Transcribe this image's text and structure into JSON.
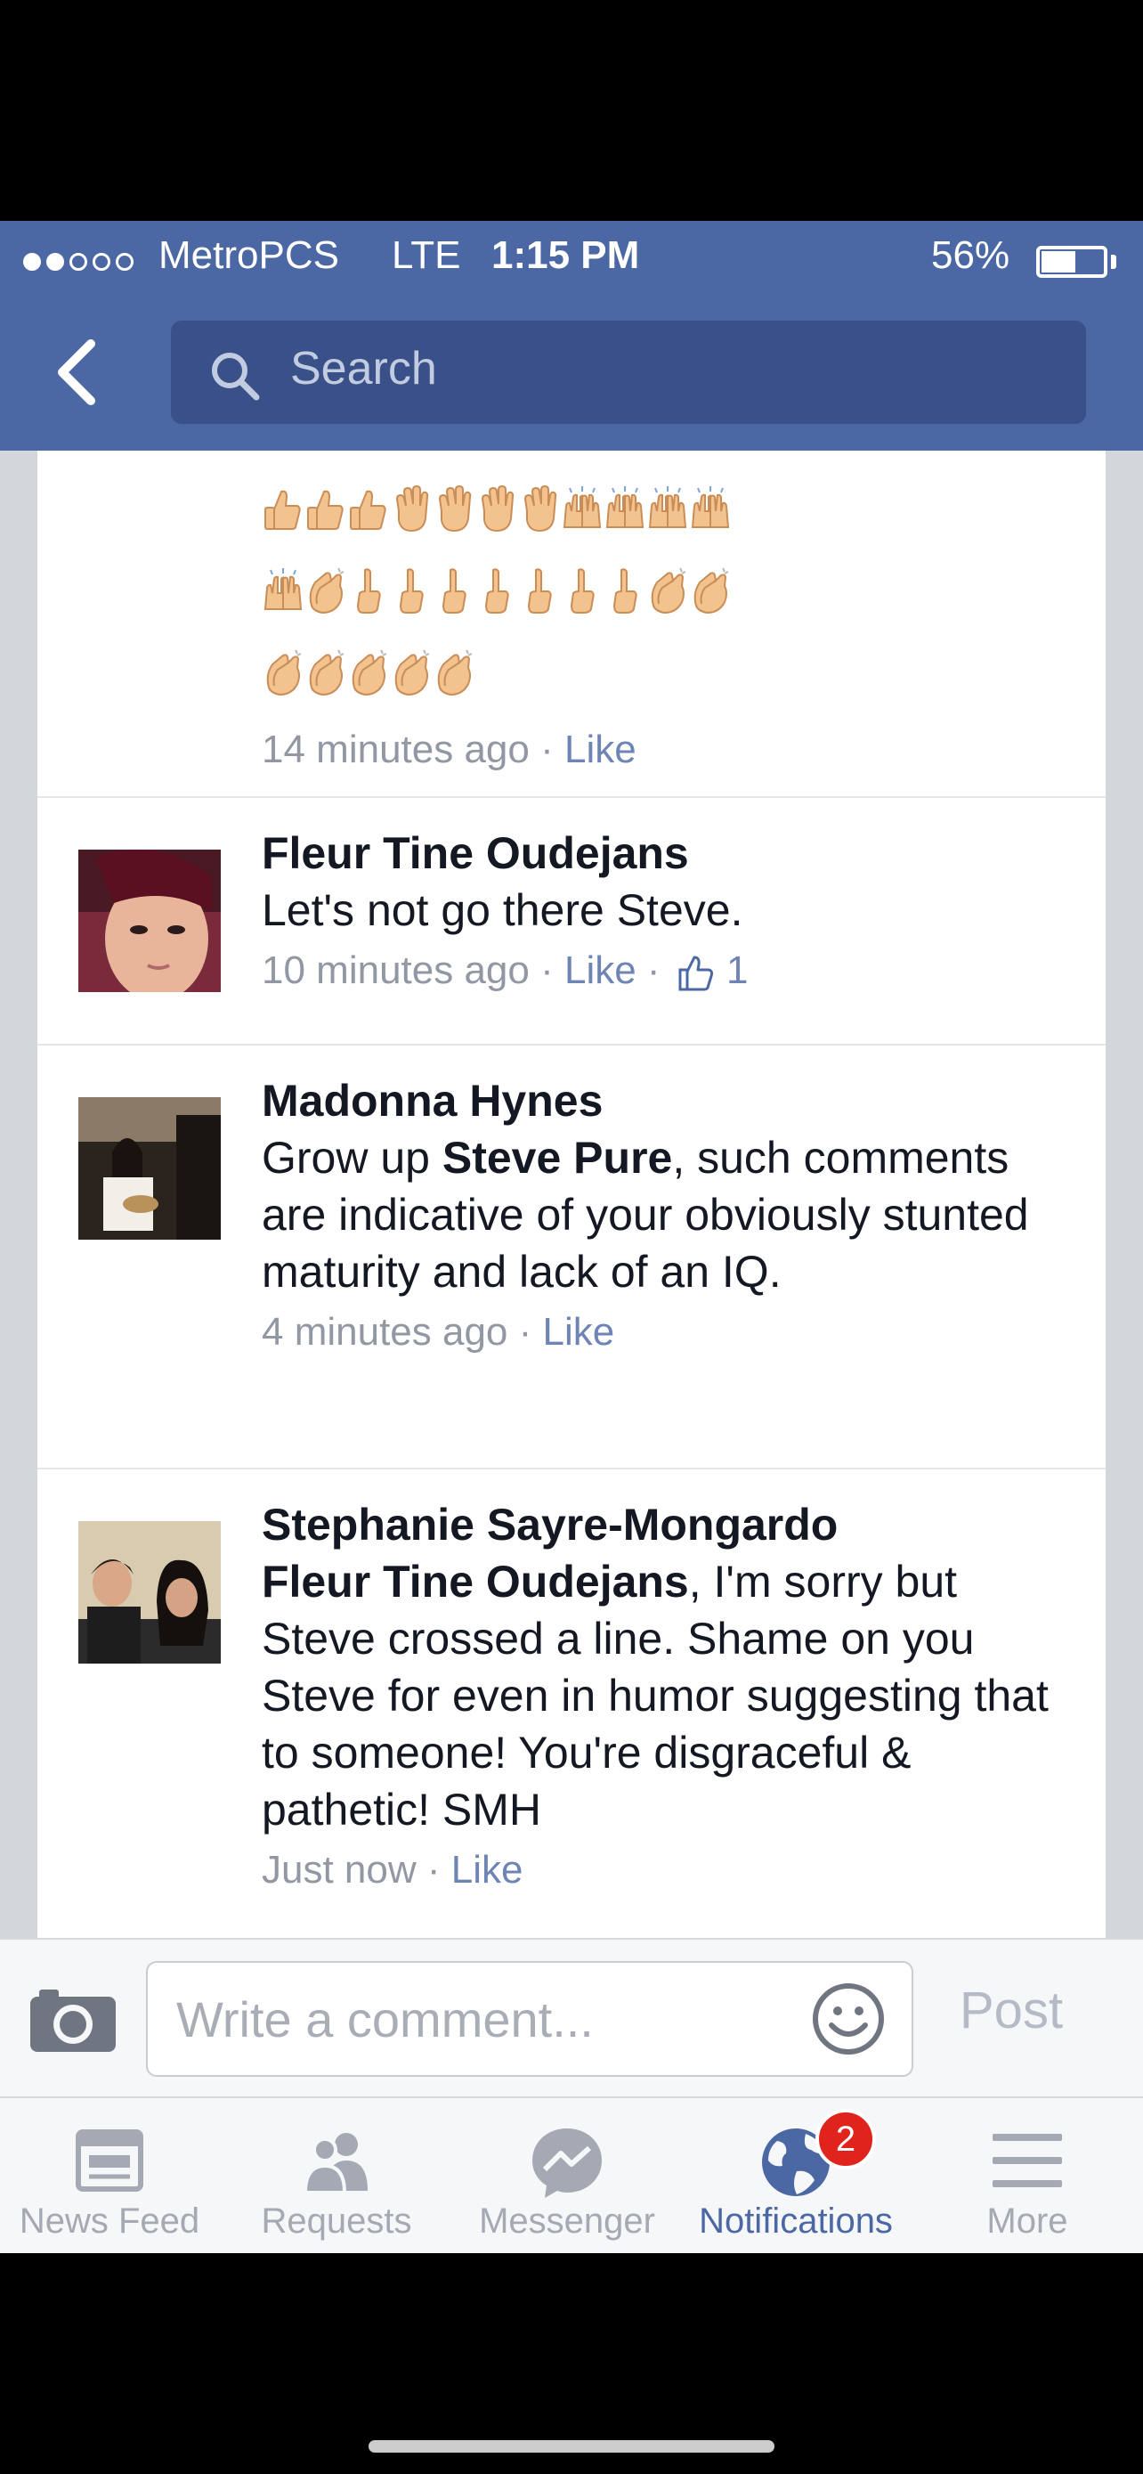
{
  "status_bar": {
    "carrier": "MetroPCS",
    "network": "LTE",
    "time": "1:15 PM",
    "battery_percent": "56%",
    "signal_bars_filled": 2,
    "signal_bars_total": 5,
    "battery_level": 0.56
  },
  "nav": {
    "back_icon": "chevron-left-icon",
    "search_placeholder": "Search",
    "search_icon": "search-icon"
  },
  "comments": [
    {
      "emoji_rows": [
        [
          "thumbs-up",
          "thumbs-up",
          "thumbs-up",
          "waving-hand",
          "waving-hand",
          "waving-hand",
          "waving-hand",
          "raising-hands",
          "raising-hands",
          "raising-hands",
          "raising-hands"
        ],
        [
          "raising-hands",
          "clapping-hands",
          "pointing-up",
          "pointing-up",
          "pointing-up",
          "pointing-up",
          "pointing-up",
          "pointing-up",
          "pointing-up",
          "clapping-hands",
          "clapping-hands"
        ],
        [
          "clapping-hands",
          "clapping-hands",
          "clapping-hands",
          "clapping-hands",
          "clapping-hands"
        ]
      ],
      "time": "14 minutes ago",
      "like_label": "Like"
    },
    {
      "name": "Fleur Tine Oudejans",
      "text": "Let's not go there Steve.",
      "time": "10 minutes ago",
      "like_label": "Like",
      "like_count": "1"
    },
    {
      "name": "Madonna Hynes",
      "text_before": "Grow up ",
      "mention": "Steve Pure",
      "text_after": ", such comments are indicative of your obviously stunted maturity and lack of an IQ.",
      "time": "4 minutes ago",
      "like_label": "Like"
    },
    {
      "name": "Stephanie Sayre-Mongardo",
      "mention": "Fleur Tine Oudejans",
      "text_after": ", I'm sorry but Steve crossed a line. Shame on you Steve for even in humor suggesting that to someone! You're disgraceful & pathetic! SMH",
      "time": "Just now",
      "like_label": "Like"
    }
  ],
  "meta_separator": " · ",
  "composer": {
    "placeholder": "Write a comment...",
    "post_label": "Post",
    "camera_icon": "camera-icon",
    "sticker_icon": "smiley-icon"
  },
  "tabs": [
    {
      "label": "News Feed",
      "icon": "news-feed-icon",
      "active": false
    },
    {
      "label": "Requests",
      "icon": "friend-requests-icon",
      "active": false
    },
    {
      "label": "Messenger",
      "icon": "messenger-icon",
      "active": false
    },
    {
      "label": "Notifications",
      "icon": "globe-icon",
      "active": true,
      "badge": "2"
    },
    {
      "label": "More",
      "icon": "menu-icon",
      "active": false
    }
  ],
  "colors": {
    "brand": "#4b67a4",
    "link": "#6d84b4",
    "badge": "#e0231c"
  }
}
